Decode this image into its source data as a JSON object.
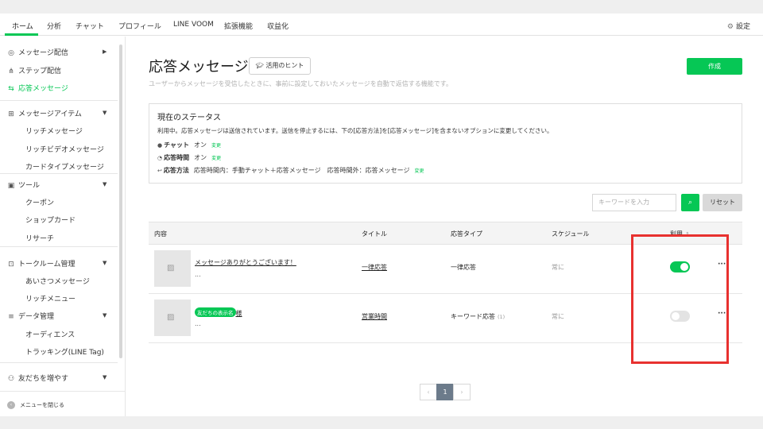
{
  "nav": {
    "tabs": [
      "ホーム",
      "分析",
      "チャット",
      "プロフィール",
      "LINE VOOM",
      "拡張機能",
      "収益化"
    ],
    "settings_label": "設定"
  },
  "sidebar": {
    "messaging": {
      "label": "メッセージ配信",
      "icon": "broadcast-icon"
    },
    "step": {
      "label": "ステップ配信",
      "icon": "step-icon"
    },
    "auto_reply": {
      "label": "応答メッセージ",
      "icon": "reply-icon"
    },
    "message_items": {
      "label": "メッセージアイテム",
      "icon": "message-item-icon",
      "children": [
        "リッチメッセージ",
        "リッチビデオメッセージ",
        "カードタイプメッセージ"
      ]
    },
    "tools": {
      "label": "ツール",
      "icon": "tool-icon",
      "children": [
        "クーポン",
        "ショップカード",
        "リサーチ"
      ]
    },
    "chatroom": {
      "label": "トークルーム管理",
      "icon": "chatroom-icon",
      "children": [
        "あいさつメッセージ",
        "リッチメニュー"
      ]
    },
    "data": {
      "label": "データ管理",
      "icon": "database-icon",
      "children": [
        "オーディエンス",
        "トラッキング(LINE Tag)"
      ]
    },
    "friends": {
      "label": "友だちを増やす",
      "icon": "add-friend-icon"
    },
    "close_menu": "メニューを閉じる"
  },
  "page": {
    "title": "応答メッセージ",
    "hint_button": "活用のヒント",
    "description": "ユーザーからメッセージを受信したときに、事前に設定しておいたメッセージを自動で返信する機能です。",
    "create_button": "作成"
  },
  "status": {
    "heading": "現在のステータス",
    "text": "利用中。応答メッセージは送信されています。送信を停止するには、下の[応答方法]を[応答メッセージ]を含まないオプションに変更してください。",
    "change_label": "変更",
    "rows": [
      {
        "label": "チャット",
        "value": "オン",
        "icon": "chat-bubble-icon"
      },
      {
        "label": "応答時間",
        "value": "オン",
        "icon": "clock-icon"
      },
      {
        "label": "応答方法",
        "value": "応答時間内：手動チャット＋応答メッセージ　応答時間外：応答メッセージ",
        "icon": "reply-arrow-icon"
      }
    ]
  },
  "filter": {
    "keyword_placeholder": "キーワードを入力",
    "reset_button": "リセット"
  },
  "table": {
    "headers": {
      "content": "内容",
      "title": "タイトル",
      "type": "応答タイプ",
      "schedule": "スケジュール",
      "enabled": "利用"
    },
    "rows": [
      {
        "content": "メッセージありがとうございます！",
        "sub": "...",
        "title": "一律応答",
        "type": "一律応答",
        "count": "",
        "schedule": "常に",
        "enabled": true
      },
      {
        "tag": "友だちの表示名",
        "content_suffix": "様",
        "sub": "...",
        "title": "営業時間",
        "type": "キーワード応答",
        "count": "(1)",
        "schedule": "常に",
        "enabled": false
      }
    ]
  },
  "pager": {
    "current": "1"
  },
  "colors": {
    "accent": "#06c755",
    "highlight": "#e8312f"
  }
}
